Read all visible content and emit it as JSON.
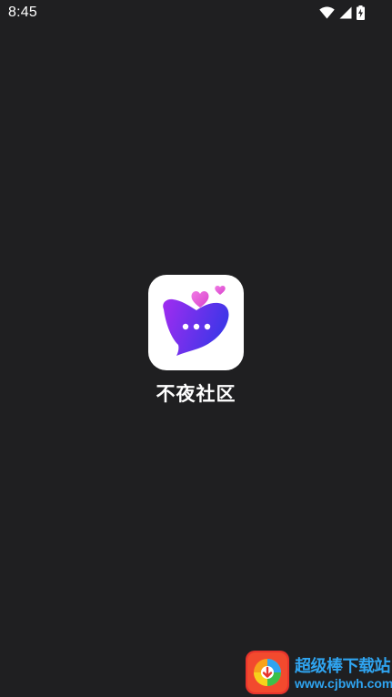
{
  "status_bar": {
    "time": "8:45",
    "icons": [
      "wifi-icon",
      "cellular-signal-icon",
      "battery-charging-icon"
    ]
  },
  "splash": {
    "app_name": "不夜社区",
    "logo_icon": "heart-chat-bubble-icon"
  },
  "watermark": {
    "title": "超级棒下载站",
    "url": "www.cjbwh.com"
  },
  "colors": {
    "background": "#1f1f21",
    "logo_tile": "#ffffff",
    "heart_gradient_start": "#a12cf0",
    "heart_gradient_end": "#3e36e8",
    "small_hearts": "#e85bd8",
    "watermark_text": "#2fa4f0"
  }
}
